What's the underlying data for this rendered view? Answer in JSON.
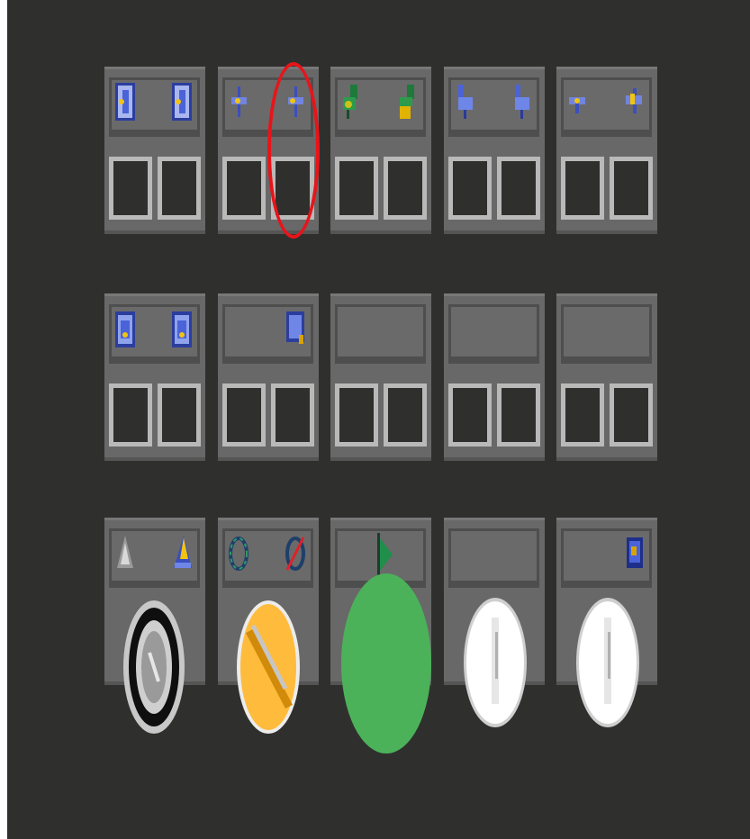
{
  "rows": [
    {
      "tiles": [
        {
          "left_icon": "blue-block-icon",
          "right_icon": "blue-block-icon",
          "slots": [
            "empty",
            "empty"
          ]
        },
        {
          "left_icon": "blue-star-icon",
          "right_icon": "blue-star-icon",
          "slots": [
            "empty",
            "empty"
          ]
        },
        {
          "left_icon": "green-link-icon",
          "right_icon": "green-yellow-link-icon",
          "slots": [
            "empty",
            "empty"
          ]
        },
        {
          "left_icon": "blue-tap-icon",
          "right_icon": "blue-tap-icon",
          "slots": [
            "empty",
            "empty"
          ]
        },
        {
          "left_icon": "blue-pin-icon",
          "right_icon": "blue-yellow-pin-icon",
          "slots": [
            "empty",
            "empty"
          ]
        }
      ]
    },
    {
      "tiles": [
        {
          "left_icon": "blue-cube-icon",
          "right_icon": "blue-cube-icon",
          "slots": [
            "empty",
            "empty"
          ]
        },
        {
          "left_icon": "",
          "right_icon": "blue-tag-icon",
          "slots": [
            "empty",
            "empty"
          ]
        },
        {
          "left_icon": "",
          "right_icon": "",
          "slots": [
            "empty",
            "empty"
          ]
        },
        {
          "left_icon": "",
          "right_icon": "",
          "slots": [
            "empty",
            "empty"
          ]
        },
        {
          "left_icon": "",
          "right_icon": "",
          "slots": [
            "empty",
            "empty"
          ]
        }
      ]
    },
    {
      "tiles": [
        {
          "left_icon": "grey-cone-icon",
          "right_icon": "yellow-cone-icon",
          "disc": "black-ring-disc"
        },
        {
          "left_icon": "green-ring-icon",
          "right_icon": "red-slash-ring-icon",
          "disc": "orange-striped-disc"
        },
        {
          "left_icon": "green-flag-icon",
          "right_icon": "",
          "disc": "green-disc"
        },
        {
          "left_icon": "",
          "right_icon": "",
          "disc": "white-disc"
        },
        {
          "left_icon": "",
          "right_icon": "blue-yellow-tag-icon",
          "disc": "white-disc"
        }
      ]
    }
  ],
  "highlight": {
    "color": "#e8141a",
    "target": "row-1-tile-2-right-slot"
  },
  "colors": {
    "background": "#2f302e",
    "tile": "#686868",
    "slot_border": "#b9b9b9",
    "disc_green": "#4cb25a",
    "disc_orange": "#ffbb3c"
  }
}
